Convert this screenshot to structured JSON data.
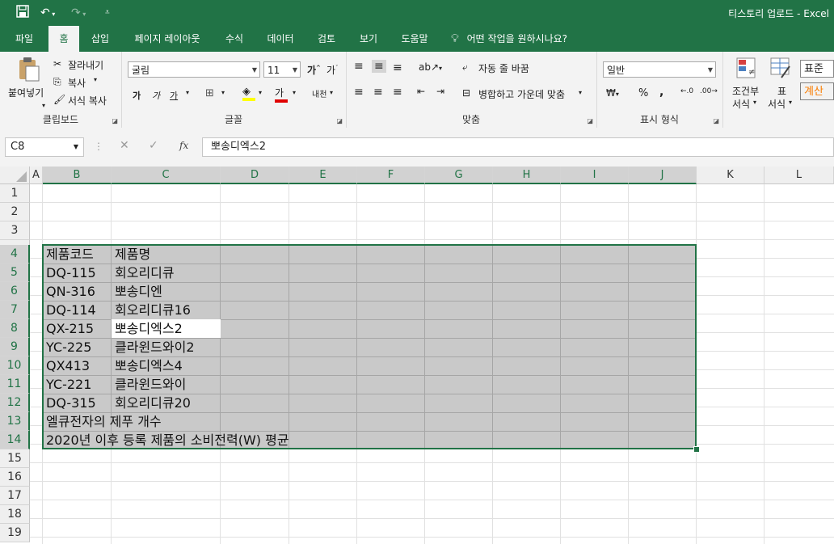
{
  "titlebar": {
    "title": "티스토리 업로드  -  Excel"
  },
  "tabs": [
    "파일",
    "홈",
    "삽입",
    "페이지 레이아웃",
    "수식",
    "데이터",
    "검토",
    "보기",
    "도움말"
  ],
  "tell_me": "어떤 작업을 원하시나요?",
  "ribbon": {
    "clipboard": {
      "paste": "붙여넣기",
      "cut": "잘라내기",
      "copy": "복사",
      "format_painter": "서식 복사",
      "label": "클립보드"
    },
    "font": {
      "name": "굴림",
      "size": "11",
      "label": "글꼴",
      "bold": "가",
      "italic": "가",
      "underline": "가",
      "font_color": "가",
      "phonetic": "내천"
    },
    "alignment": {
      "wrap": "자동 줄 바꿈",
      "merge": "병합하고 가운데 맞춤",
      "label": "맞춤"
    },
    "number": {
      "format": "일반",
      "percent": "%",
      "comma": ",",
      "label": "표시 형식"
    },
    "styles": {
      "conditional": "조건부",
      "conditional2": "서식",
      "table": "표",
      "table2": "서식",
      "normal": "표준",
      "calc": "계산"
    }
  },
  "formula_bar": {
    "name_box": "C8",
    "value": "뽀송디엑스2",
    "fx": "fx"
  },
  "columns": [
    "A",
    "B",
    "C",
    "D",
    "E",
    "F",
    "G",
    "H",
    "I",
    "J",
    "K",
    "L"
  ],
  "rows": [
    "1",
    "2",
    "3",
    "4",
    "5",
    "6",
    "7",
    "8",
    "9",
    "10",
    "11",
    "12",
    "13",
    "14",
    "15",
    "16",
    "17",
    "18",
    "19"
  ],
  "cells": {
    "B4": "제품코드",
    "C4": "제품명",
    "B5": "DQ-115",
    "C5": "회오리디큐",
    "B6": "QN-316",
    "C6": "뽀송디엔",
    "B7": "DQ-114",
    "C7": "회오리디큐16",
    "B8": "QX-215",
    "C8": "뽀송디엑스2",
    "B9": "YC-225",
    "C9": "클라윈드와이2",
    "B10": "QX413",
    "C10": "뽀송디엑스4",
    "B11": "YC-221",
    "C11": "클라윈드와이",
    "B12": "DQ-315",
    "C12": "회오리디큐20",
    "B13": "엘큐전자의 제푸 개수",
    "B14": "2020년 이후 등록 제품의 소비전력(W) 평균"
  },
  "colors": {
    "accent": "#217346",
    "selection": "#c9c9c9"
  }
}
